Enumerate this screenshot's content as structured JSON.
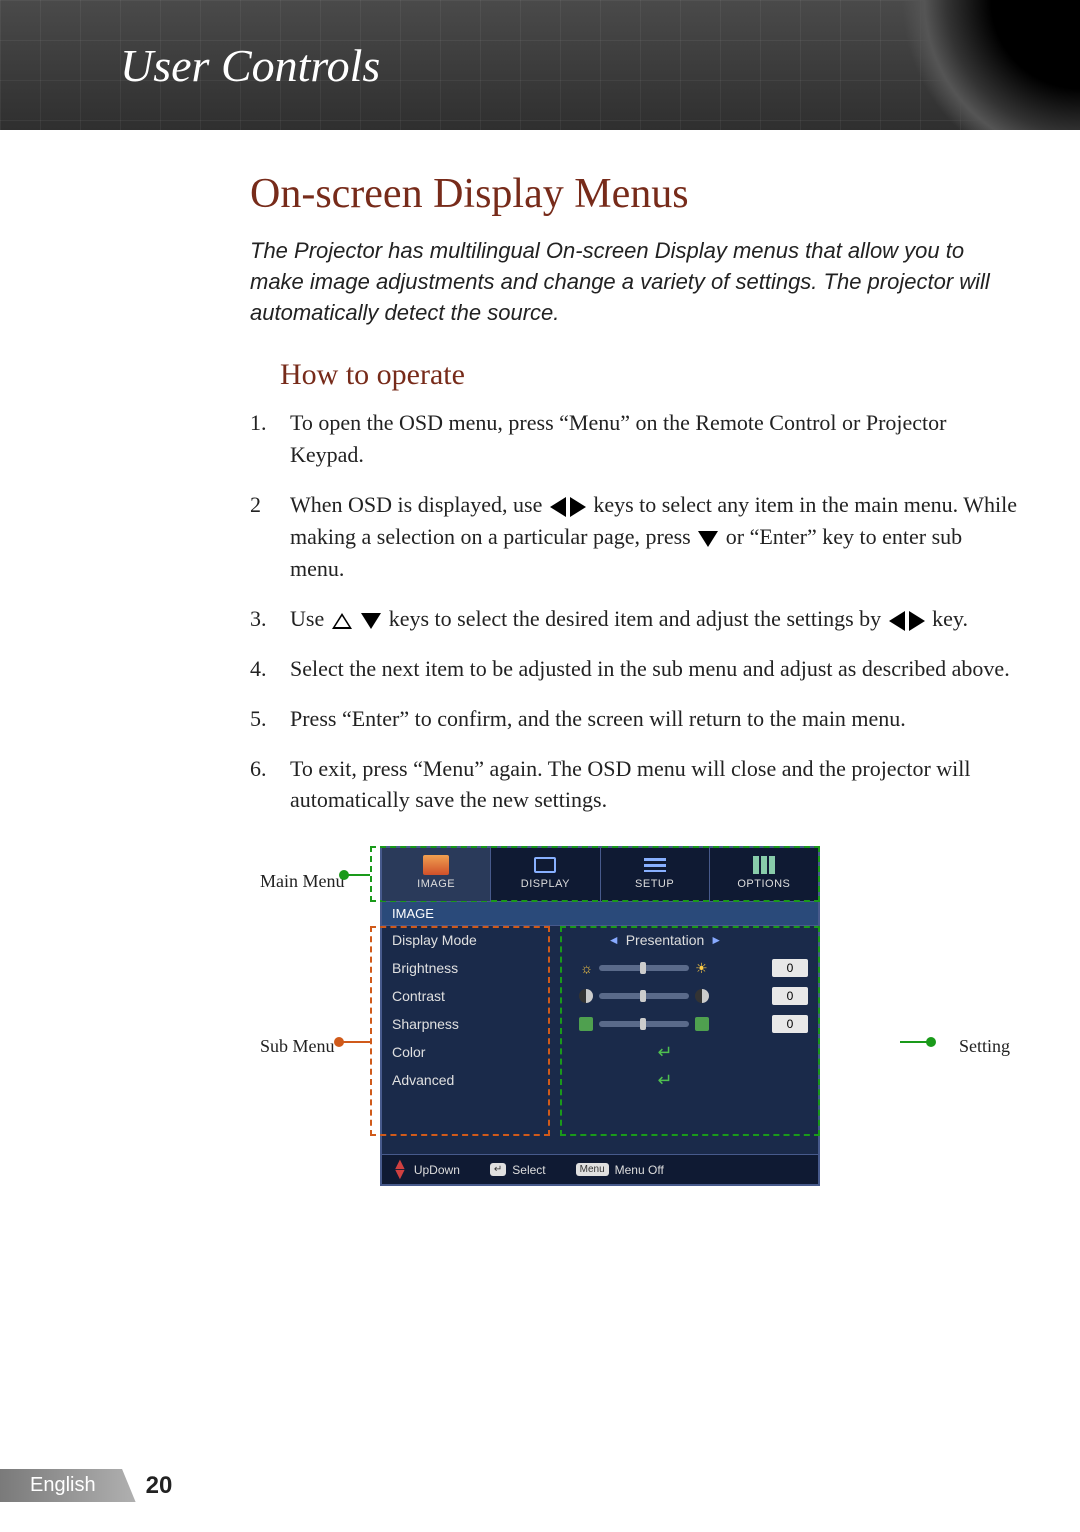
{
  "header": {
    "title": "User Controls"
  },
  "page": {
    "title": "On-screen Display Menus",
    "intro": "The Projector has multilingual On-screen Display menus that allow you to make image adjustments and change a variety of settings. The projector will automatically detect the source.",
    "subtitle": "How to operate"
  },
  "steps": {
    "s1": "To open the OSD menu, press “Menu” on the Remote Control or Projector Keypad.",
    "s2a": "When OSD is displayed, use ",
    "s2b": " keys to select any item in the main menu. While making a selection on a particular page, press ",
    "s2c": " or “Enter” key to enter sub menu.",
    "s3a": "Use ",
    "s3b": " keys to select the desired item and adjust the settings by ",
    "s3c": " key.",
    "s4": "Select the next item to be adjusted in the sub menu and adjust as described above.",
    "s5": "Press “Enter” to confirm, and the screen will return to the main menu.",
    "s6": "To exit, press “Menu” again. The OSD menu will close and the projector will automatically save the new settings."
  },
  "osd": {
    "labels": {
      "main": "Main Menu",
      "sub": "Sub Menu",
      "setting": "Setting"
    },
    "tabs": [
      "IMAGE",
      "DISPLAY",
      "SETUP",
      "OPTIONS"
    ],
    "subhead": "IMAGE",
    "rows": {
      "display_mode": {
        "label": "Display Mode",
        "value": "Presentation"
      },
      "brightness": {
        "label": "Brightness",
        "value": "0"
      },
      "contrast": {
        "label": "Contrast",
        "value": "0"
      },
      "sharpness": {
        "label": "Sharpness",
        "value": "0"
      },
      "color": {
        "label": "Color"
      },
      "advanced": {
        "label": "Advanced"
      }
    },
    "footer": {
      "updown": "UpDown",
      "select": "Select",
      "menu_off": "Menu Off",
      "menu_key": "Menu"
    }
  },
  "footer": {
    "language": "English",
    "page_number": "20"
  }
}
